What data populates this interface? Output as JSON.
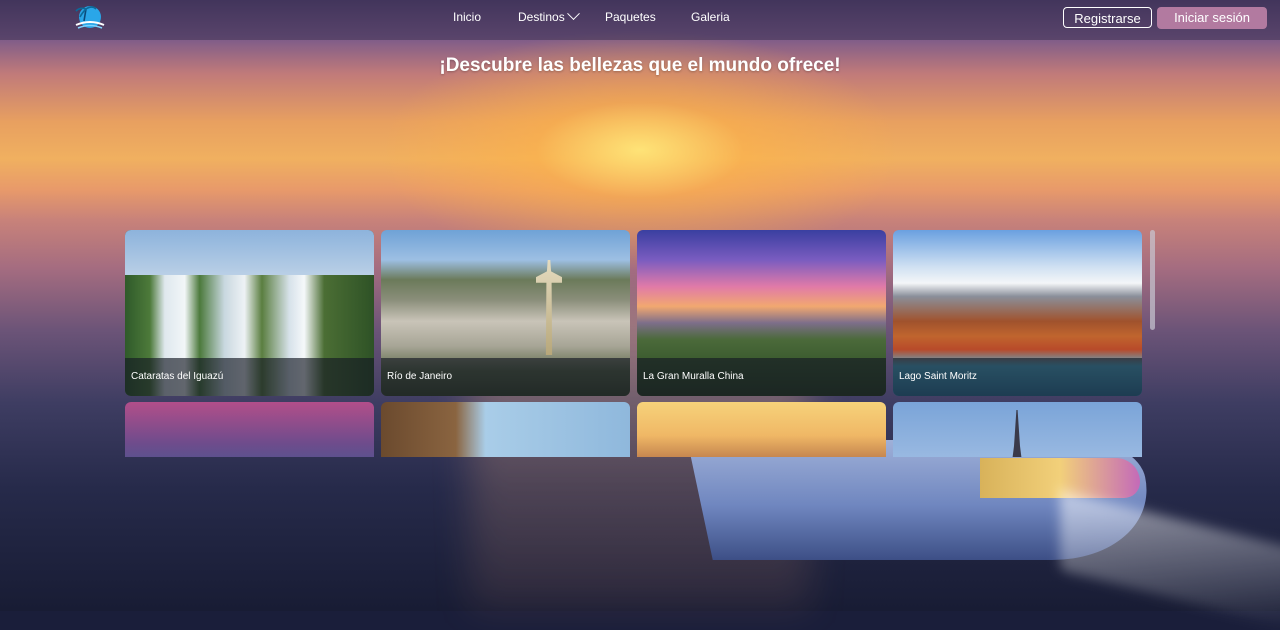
{
  "nav": {
    "links": [
      "Inicio",
      "Destinos",
      "Paquetes",
      "Galeria"
    ],
    "register_label": "Registrarse",
    "login_label": "Iniciar sesión",
    "logo_icon": "palm-island-logo-icon"
  },
  "hero": {
    "title": "¡Descubre las bellezas que el mundo ofrece!"
  },
  "destinations": [
    {
      "name": "Cataratas del Iguazú"
    },
    {
      "name": "Río de Janeiro"
    },
    {
      "name": "La Gran Muralla China"
    },
    {
      "name": "Lago Saint Moritz"
    },
    {
      "name": ""
    },
    {
      "name": ""
    },
    {
      "name": ""
    },
    {
      "name": ""
    }
  ],
  "colors": {
    "login_button": "#b27aa0",
    "navbar": "#3c3250"
  }
}
